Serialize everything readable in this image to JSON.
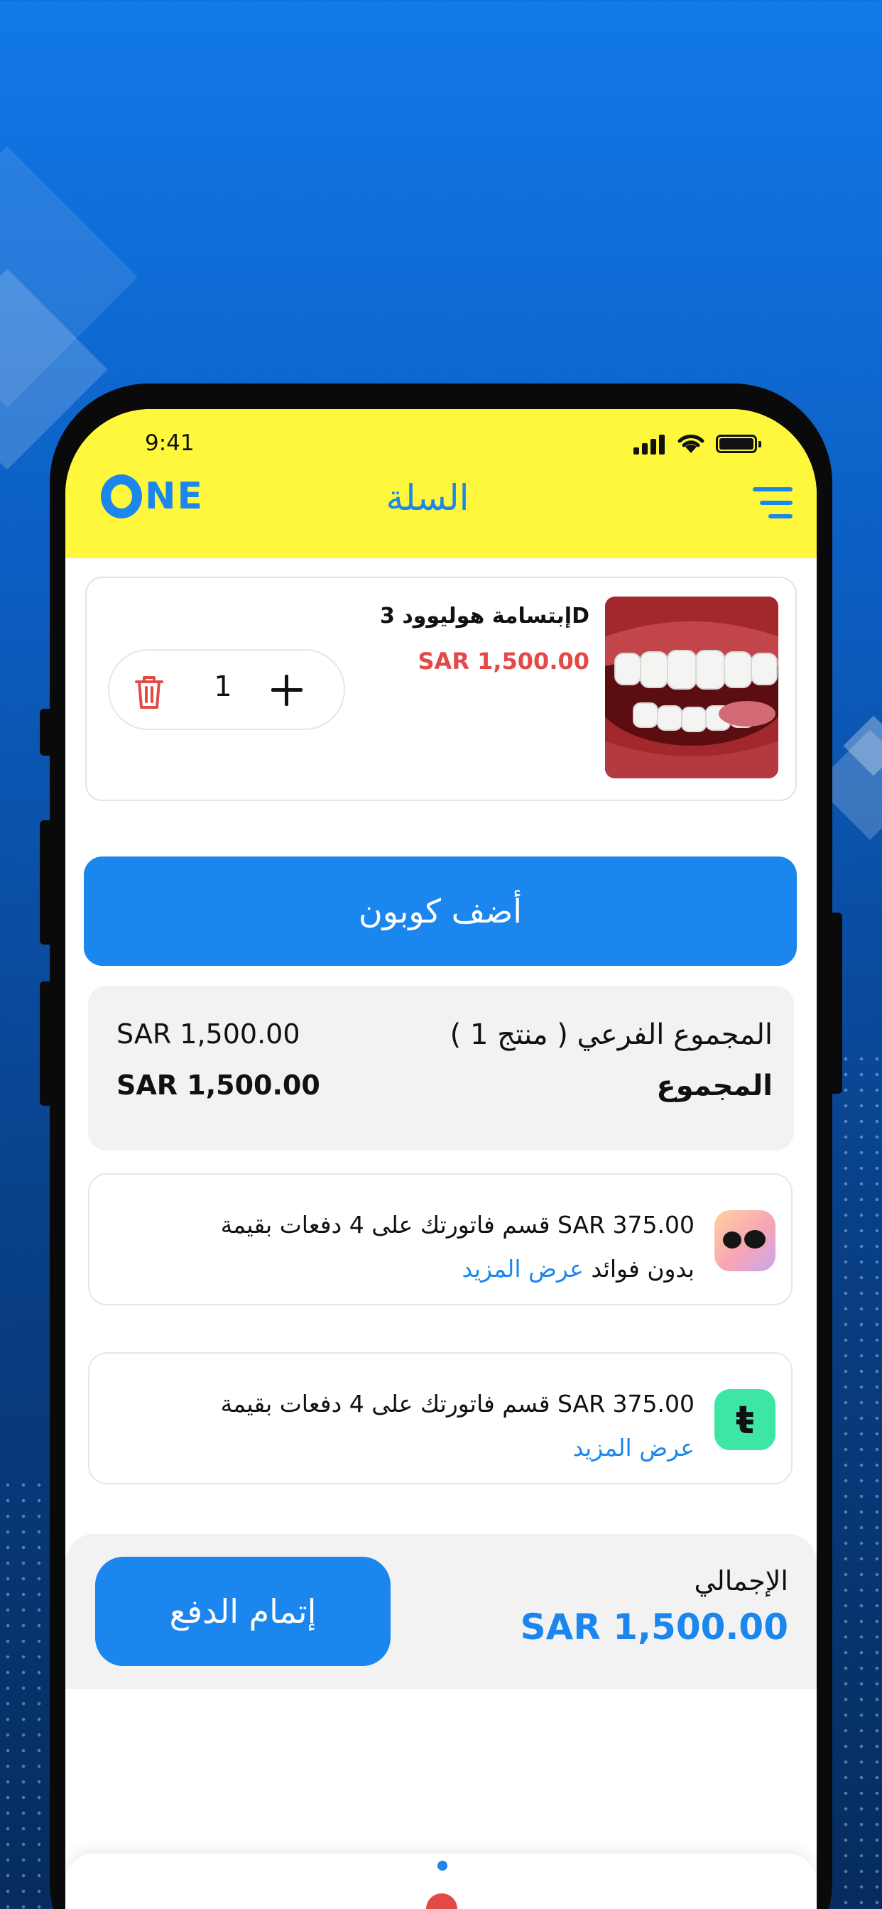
{
  "status_bar": {
    "time": "9:41"
  },
  "header": {
    "logo_text": "NE",
    "title": "السلة"
  },
  "cart_item": {
    "name": "إبتسامة هوليوود 3D",
    "price": "SAR 1,500.00",
    "quantity": "1"
  },
  "coupon": {
    "label": "أضف كوبون"
  },
  "summary": {
    "subtotal_label": "المجموع الفرعي ( منتج 1 )",
    "subtotal_value": "SAR 1,500.00",
    "total_label": "المجموع",
    "total_value": "SAR 1,500.00"
  },
  "installments": {
    "tabby": {
      "text": "قسم فاتورتك على 4 دفعات بقيمة SAR 375.00",
      "note": "بدون فوائد",
      "link": "عرض المزيد"
    },
    "tamara": {
      "text": "قسم فاتورتك على 4 دفعات بقيمة SAR 375.00",
      "link": "عرض المزيد",
      "logo_glyph": "ŧ"
    }
  },
  "checkout": {
    "grand_total_label": "الإجمالي",
    "grand_total_value": "SAR 1,500.00",
    "button_label": "إتمام الدفع"
  },
  "colors": {
    "accent": "#1a86ee",
    "header_bg": "#fff73b",
    "price_red": "#e24a48",
    "background": "#0c5ec2"
  },
  "icons": [
    "menu-icon",
    "trash-icon",
    "plus-icon",
    "signal-icon",
    "wifi-icon",
    "battery-icon"
  ]
}
